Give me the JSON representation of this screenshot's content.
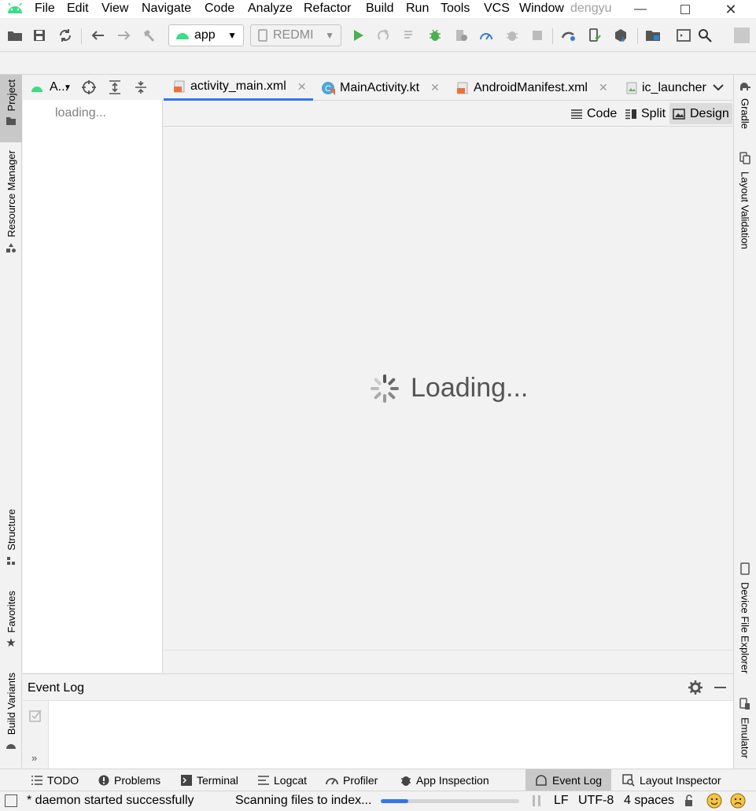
{
  "menu": {
    "items": [
      "File",
      "Edit",
      "View",
      "Navigate",
      "Code",
      "Analyze",
      "Refactor",
      "Build",
      "Run",
      "Tools",
      "VCS",
      "Window"
    ],
    "user": "dengyu"
  },
  "toolbar": {
    "run_config": "app",
    "device": "REDMI"
  },
  "project_panel": {
    "title": "A...",
    "loading_text": "loading..."
  },
  "editor": {
    "tabs": [
      {
        "label": "activity_main.xml",
        "active": true,
        "closable": true
      },
      {
        "label": "MainActivity.kt",
        "active": false,
        "closable": true
      },
      {
        "label": "AndroidManifest.xml",
        "active": false,
        "closable": true
      },
      {
        "label": "ic_launcher",
        "active": false,
        "closable": false
      }
    ],
    "view_modes": [
      "Code",
      "Split",
      "Design"
    ],
    "selected_mode": "Design",
    "loading_text": "Loading..."
  },
  "left_stripe": {
    "top": [
      "Project",
      "Resource Manager"
    ],
    "bottom": [
      "Structure",
      "Favorites",
      "Build Variants"
    ]
  },
  "right_stripe": {
    "top": [
      "Gradle",
      "Layout Validation"
    ],
    "bottom": [
      "Device File Explorer",
      "Emulator"
    ]
  },
  "event_log": {
    "title": "Event Log"
  },
  "bottom_tools": [
    "TODO",
    "Problems",
    "Terminal",
    "Logcat",
    "Profiler",
    "App Inspection",
    "Event Log",
    "Layout Inspector"
  ],
  "status": {
    "message": "* daemon started successfully",
    "progress_text": "Scanning files to index...",
    "progress": 0.2,
    "line_separator": "LF",
    "encoding": "UTF-8",
    "indent": "4 spaces"
  },
  "colors": {
    "accent": "#3574f0",
    "android_green": "#3ddc84",
    "run_green": "#4caf50",
    "xml_orange": "#e8743b"
  }
}
